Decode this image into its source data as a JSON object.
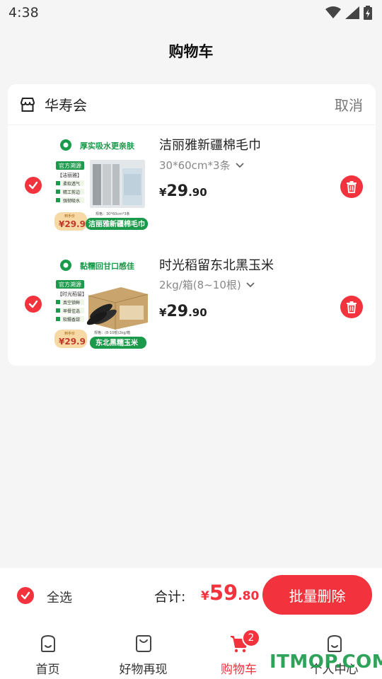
{
  "status_bar": {
    "time": "4:38"
  },
  "header": {
    "title": "购物车"
  },
  "shop": {
    "name": "华寿会",
    "cancel_label": "取消"
  },
  "items": [
    {
      "title": "洁丽雅新疆棉毛巾",
      "spec": "30*60cm*3条",
      "price_symbol": "¥",
      "price_int": "29",
      "price_dec": ".90",
      "thumb": {
        "headline": "厚实吸水更亲肤",
        "badge": "官方溯源",
        "brand": "【洁丽雅】",
        "tags": [
          "柔软透气",
          "精工剪边",
          "强韧吸水"
        ],
        "promo_label": "到手价",
        "promo_price": "¥29.9",
        "spec_line": "规格：30*60cm*3条",
        "name_banner": "洁丽雅新疆棉毛巾"
      }
    },
    {
      "title": "时光稻留东北黑玉米",
      "spec": "2kg/箱(8~10根)",
      "price_symbol": "¥",
      "price_int": "29",
      "price_dec": ".90",
      "thumb": {
        "headline": "黏糯回甘口感佳",
        "badge": "官方溯源",
        "brand": "【时光稻留】",
        "tags": [
          "真空锁鲜",
          "早餐佳选",
          "软糯香甜"
        ],
        "promo_label": "到手价",
        "promo_price": "¥29.9",
        "spec_line": "规格：(8-10根)2kg/箱",
        "name_banner": "东北黑糯玉米"
      }
    }
  ],
  "bottom_bar": {
    "select_all_label": "全选",
    "total_label": "合计:",
    "total_symbol": "¥",
    "total_int": "59",
    "total_dec": ".80",
    "batch_delete_label": "批量删除"
  },
  "tabs": [
    {
      "label": "首页",
      "icon": "home-bag-icon"
    },
    {
      "label": "好物再现",
      "icon": "shopping-bag-icon"
    },
    {
      "label": "购物车",
      "icon": "cart-icon",
      "badge": "2",
      "active": true
    },
    {
      "label": "个人中心",
      "icon": "profile-bag-icon"
    }
  ],
  "watermark": "ITMOP.COM",
  "colors": {
    "accent": "#f2333d",
    "green": "#1a9a4a",
    "background": "#f5f5f5"
  }
}
